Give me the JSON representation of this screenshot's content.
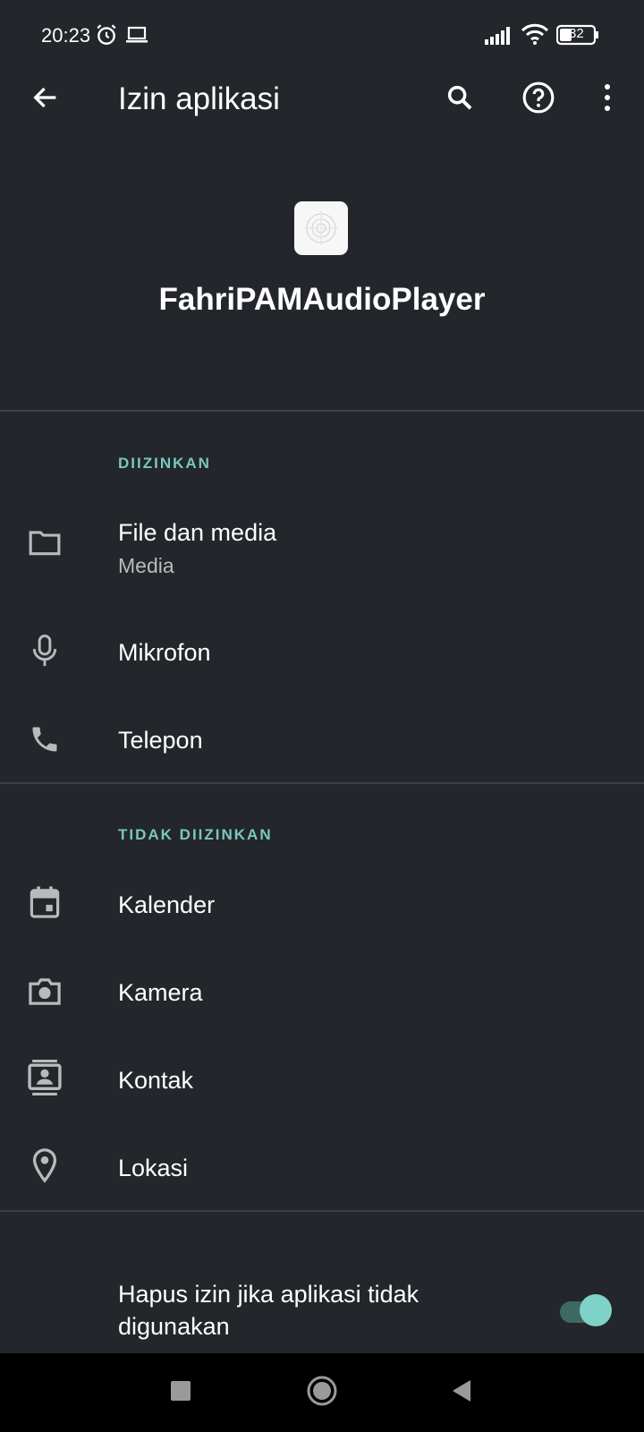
{
  "status_bar": {
    "time": "20:23",
    "battery": "32",
    "icons": [
      "alarm-icon",
      "laptop-icon",
      "signal-icon",
      "wifi-icon",
      "battery-icon"
    ]
  },
  "app_bar": {
    "title": "Izin aplikasi",
    "icons": [
      "back-arrow-icon",
      "search-icon",
      "help-icon",
      "more-vert-icon"
    ]
  },
  "app": {
    "name": "FahriPAMAudioPlayer"
  },
  "sections": {
    "allowed": {
      "header": "DIIZINKAN",
      "items": [
        {
          "label": "File dan media",
          "sub": "Media",
          "icon": "folder-icon"
        },
        {
          "label": "Mikrofon",
          "icon": "microphone-icon"
        },
        {
          "label": "Telepon",
          "icon": "phone-icon"
        }
      ]
    },
    "denied": {
      "header": "TIDAK DIIZINKAN",
      "items": [
        {
          "label": "Kalender",
          "icon": "calendar-icon"
        },
        {
          "label": "Kamera",
          "icon": "camera-icon"
        },
        {
          "label": "Kontak",
          "icon": "contacts-icon"
        },
        {
          "label": "Lokasi",
          "icon": "location-icon"
        }
      ]
    }
  },
  "auto_revoke": {
    "label": "Hapus izin jika aplikasi tidak digunakan",
    "enabled": true
  },
  "colors": {
    "background": "#23262a",
    "accent": "#79c8bf",
    "toggle_thumb": "#7fd2c8",
    "nav_bar": "#000000"
  },
  "nav_bar": {
    "icons": [
      "recents-square-icon",
      "home-circle-icon",
      "back-triangle-icon"
    ]
  }
}
